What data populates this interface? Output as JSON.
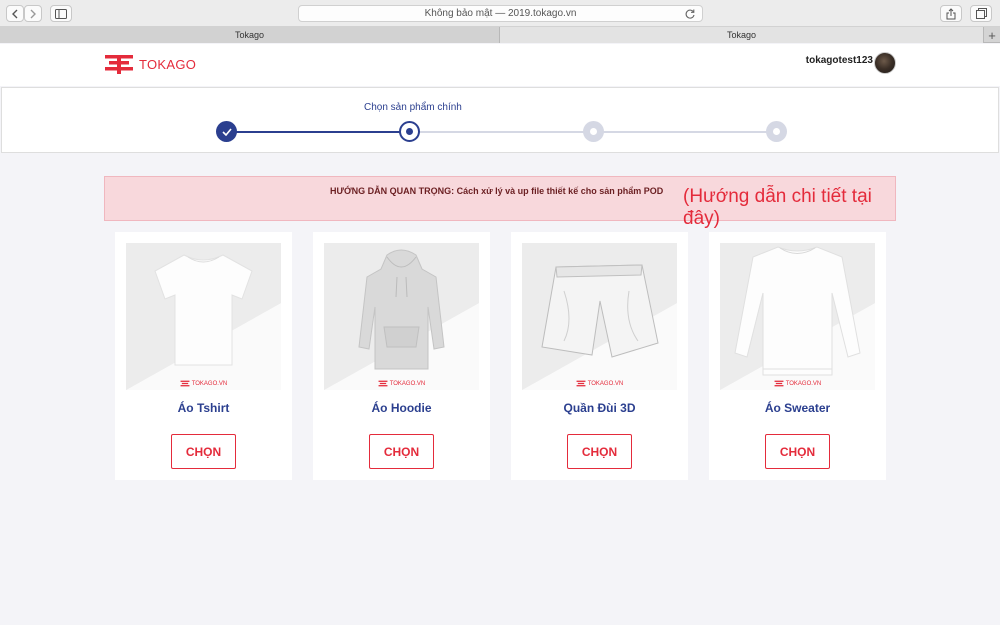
{
  "browser": {
    "address": "Không bảo mật — 2019.tokago.vn",
    "tabs": [
      "Tokago",
      "Tokago"
    ],
    "new_tab": "+"
  },
  "site": {
    "logo_text": "TOKAGO",
    "username": "tokagotest123",
    "brand_color": "#e42b3b",
    "accent_color": "#2b3f8f"
  },
  "stepper": {
    "current_label": "Chọn sản phẩm chính",
    "steps": [
      "done",
      "active",
      "pending",
      "pending"
    ]
  },
  "notice": {
    "text": "HƯỚNG DẪN QUAN TRỌNG: Cách xử lý và up file thiết kế cho sản phẩm POD",
    "link": "(Hướng dẫn chi tiết tại đây)"
  },
  "products": [
    {
      "name": "Áo Tshirt",
      "button": "CHỌN",
      "watermark": "TOKAGO.VN",
      "icon": "tshirt-icon"
    },
    {
      "name": "Áo Hoodie",
      "button": "CHỌN",
      "watermark": "TOKAGO.VN",
      "icon": "hoodie-icon"
    },
    {
      "name": "Quần Đùi 3D",
      "button": "CHỌN",
      "watermark": "TOKAGO.VN",
      "icon": "shorts-icon"
    },
    {
      "name": "Áo Sweater",
      "button": "CHỌN",
      "watermark": "TOKAGO.VN",
      "icon": "sweater-icon"
    }
  ]
}
